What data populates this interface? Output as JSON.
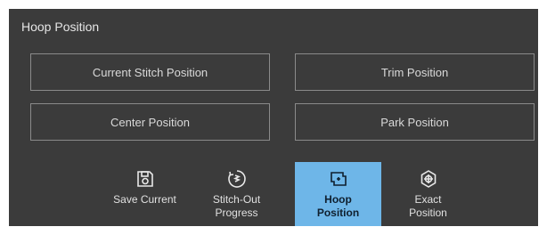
{
  "panel": {
    "title": "Hoop Position"
  },
  "positions": [
    {
      "label": "Current Stitch Position"
    },
    {
      "label": "Trim Position"
    },
    {
      "label": "Center Position"
    },
    {
      "label": "Park Position"
    }
  ],
  "toolbar": [
    {
      "icon": "save-icon",
      "lines": [
        "Save Current"
      ]
    },
    {
      "icon": "stitch-out-progress-icon",
      "lines": [
        "Stitch-Out",
        "Progress"
      ]
    },
    {
      "icon": "hoop-position-icon",
      "lines": [
        "Hoop",
        "Position"
      ],
      "active": true
    },
    {
      "icon": "exact-position-icon",
      "lines": [
        "Exact",
        "Position"
      ]
    }
  ],
  "colors": {
    "panel_bg": "#3b3b3b",
    "active_bg": "#6eb6e8",
    "border": "#8a8a8a"
  }
}
